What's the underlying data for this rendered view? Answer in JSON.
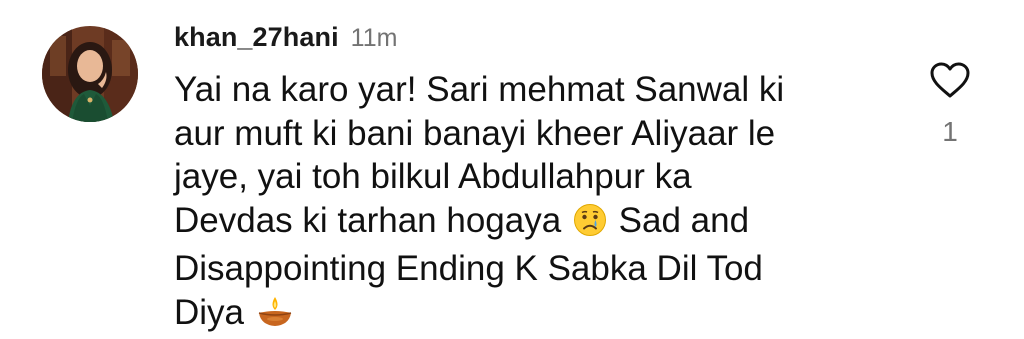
{
  "comment": {
    "username": "khan_27hani",
    "time": "11m",
    "text_part1": "Yai na karo yar! Sari mehmat Sanwal ki\naur muft ki bani banayi kheer Aliyaar le\njaye, yai toh bilkul Abdullahpur ka\nDevdas ki tarhan hogaya",
    "emoji1": "crying-face-icon",
    "text_part2": "Sad and\nDisappointing Ending K Sabka Dil Tod\nDiya",
    "emoji2": "diya-lamp-icon",
    "like_count": "1",
    "like_icon": "heart-outline-icon"
  },
  "colors": {
    "text": "#111111",
    "muted": "#737373",
    "background": "#ffffff"
  }
}
